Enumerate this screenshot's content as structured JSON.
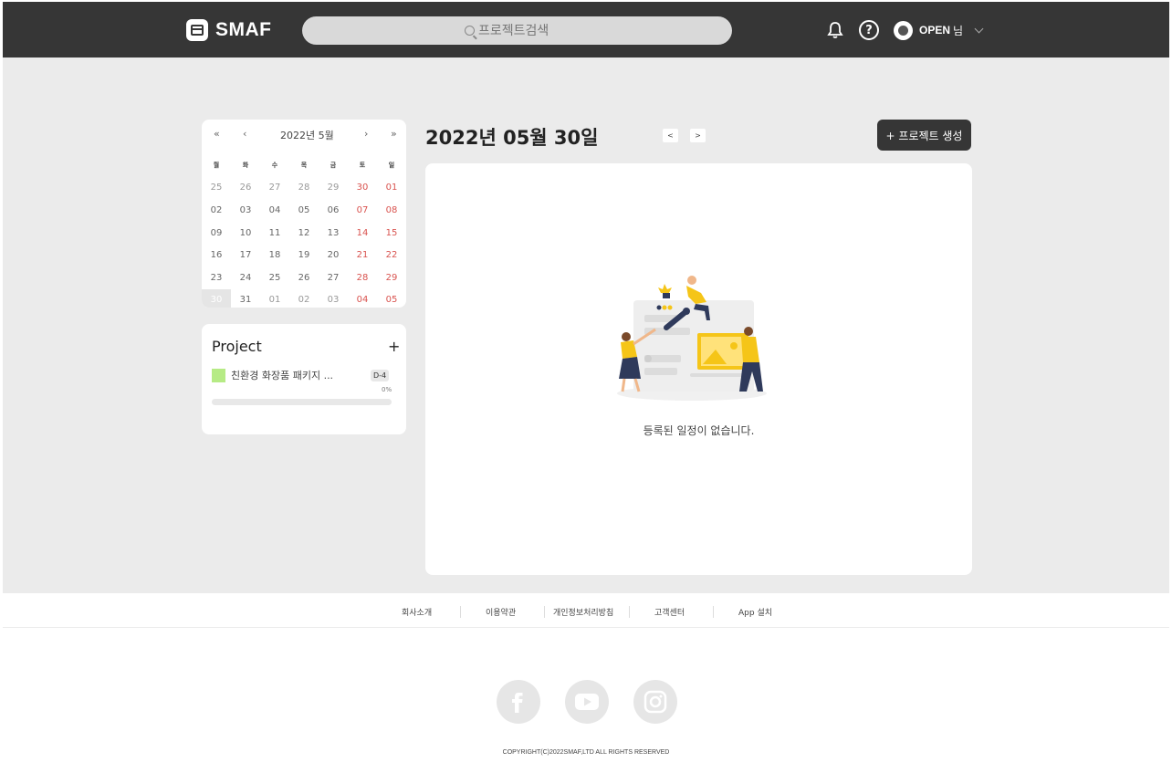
{
  "header": {
    "logo_text": "SMAF",
    "search_placeholder": "프로젝트검색",
    "user_name": "OPEN",
    "user_suffix": "님",
    "help_label": "?"
  },
  "calendar": {
    "title": "2022년 5월",
    "nav": {
      "prev_year": "«",
      "prev_month": "‹",
      "next_month": "›",
      "next_year": "»"
    },
    "weekdays": [
      "월",
      "화",
      "수",
      "목",
      "금",
      "토",
      "일"
    ],
    "weeks": [
      [
        "25",
        "26",
        "27",
        "28",
        "29",
        "30",
        "01"
      ],
      [
        "02",
        "03",
        "04",
        "05",
        "06",
        "07",
        "08"
      ],
      [
        "09",
        "10",
        "11",
        "12",
        "13",
        "14",
        "15"
      ],
      [
        "16",
        "17",
        "18",
        "19",
        "20",
        "21",
        "22"
      ],
      [
        "23",
        "24",
        "25",
        "26",
        "27",
        "28",
        "29"
      ],
      [
        "30",
        "31",
        "01",
        "02",
        "03",
        "04",
        "05"
      ]
    ],
    "selected": "30",
    "weekend_color": "#d9534f"
  },
  "project_panel": {
    "title": "Project",
    "add_label": "+",
    "items": [
      {
        "name": "친환경 화장품 패키지 ...",
        "dday": "D-4",
        "progress_label": "0%",
        "progress": 0,
        "color": "#b6eb85"
      }
    ]
  },
  "schedule": {
    "date_title": "2022년 05월 30일",
    "prev_label": "<",
    "next_label": ">",
    "create_button": "+ 프로젝트 생성",
    "empty_message": "등록된 일정이 없습니다."
  },
  "footer": {
    "links": [
      "회사소개",
      "이용약관",
      "개인정보처리방침",
      "고객센터",
      "App 설치"
    ],
    "social": [
      "facebook-icon",
      "youtube-icon",
      "instagram-icon"
    ],
    "copyright": "COPYRIGHT(C)2022SMAF,LTD ALL RIGHTS RESERVED"
  },
  "colors": {
    "header_bg": "#363636",
    "page_bg": "#ebebeb",
    "accent_yellow": "#f5c518",
    "project_green": "#b6eb85"
  }
}
